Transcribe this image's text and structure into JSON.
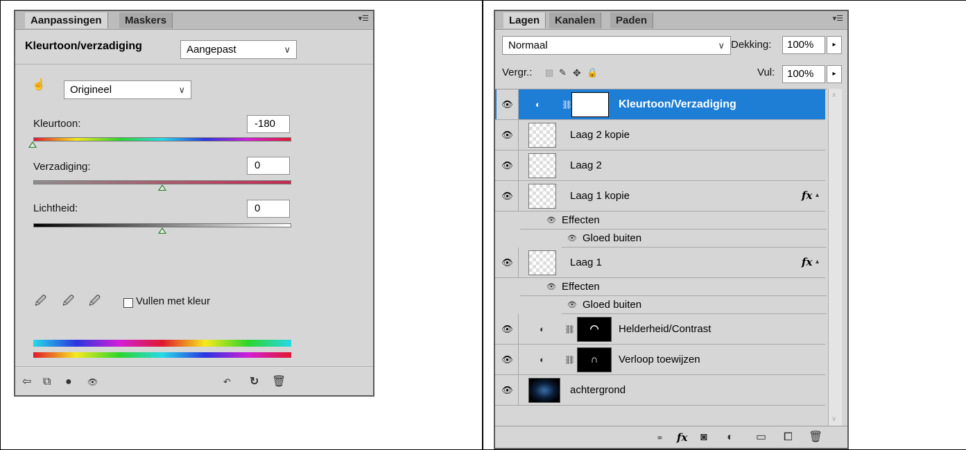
{
  "left_panel": {
    "tabs": [
      "Aanpassingen",
      "Maskers"
    ],
    "title": "Kleurtoon/verzadiging",
    "preset_value": "Aangepast",
    "range_value": "Origineel",
    "hue_label": "Kleurtoon:",
    "hue_value": "-180",
    "saturation_label": "Verzadiging:",
    "saturation_value": "0",
    "lightness_label": "Lichtheid:",
    "lightness_value": "0",
    "colorize_label": "Vullen met kleur"
  },
  "right_panel": {
    "tabs": [
      "Lagen",
      "Kanalen",
      "Paden"
    ],
    "blend_mode": "Normaal",
    "opacity_label": "Dekking:",
    "opacity_value": "100%",
    "lock_label": "Vergr.:",
    "fill_label": "Vul:",
    "fill_value": "100%",
    "layers": [
      {
        "name": "Kleurtoon/Verzadiging"
      },
      {
        "name": "Laag 2 kopie"
      },
      {
        "name": "Laag 2"
      },
      {
        "name": "Laag 1 kopie"
      },
      {
        "name": "Laag 1"
      },
      {
        "name": "Helderheid/Contrast"
      },
      {
        "name": "Verloop toewijzen"
      },
      {
        "name": "achtergrond"
      }
    ],
    "effects_label": "Effecten",
    "effect_name": "Gloed buiten",
    "fx_label": "fx"
  },
  "colors": {
    "selection": "#1e7ed6",
    "panel_bg": "#d6d6d6"
  }
}
